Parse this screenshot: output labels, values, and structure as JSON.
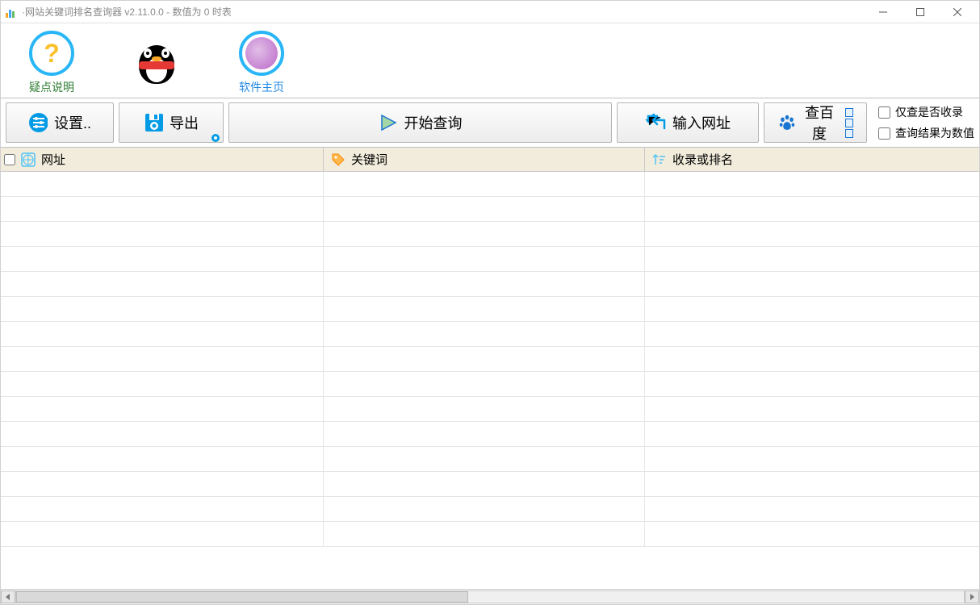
{
  "window": {
    "title": "·网站关键词排名查询器 v2.11.0.0 - 数值为 0 时表"
  },
  "iconbar": {
    "help_label": "疑点说明",
    "qq_label": "",
    "home_label": "软件主页"
  },
  "toolbar": {
    "settings_label": "设置..",
    "export_label": "导出",
    "start_label": "开始查询",
    "input_url_label": "输入网址",
    "baidu_label": "查百度"
  },
  "checks": {
    "only_indexed": "仅查是否收录",
    "result_numeric": "查询结果为数值"
  },
  "table": {
    "headers": {
      "url": "网址",
      "keyword": "关键词",
      "rank": "收录或排名"
    },
    "rows": 15
  }
}
